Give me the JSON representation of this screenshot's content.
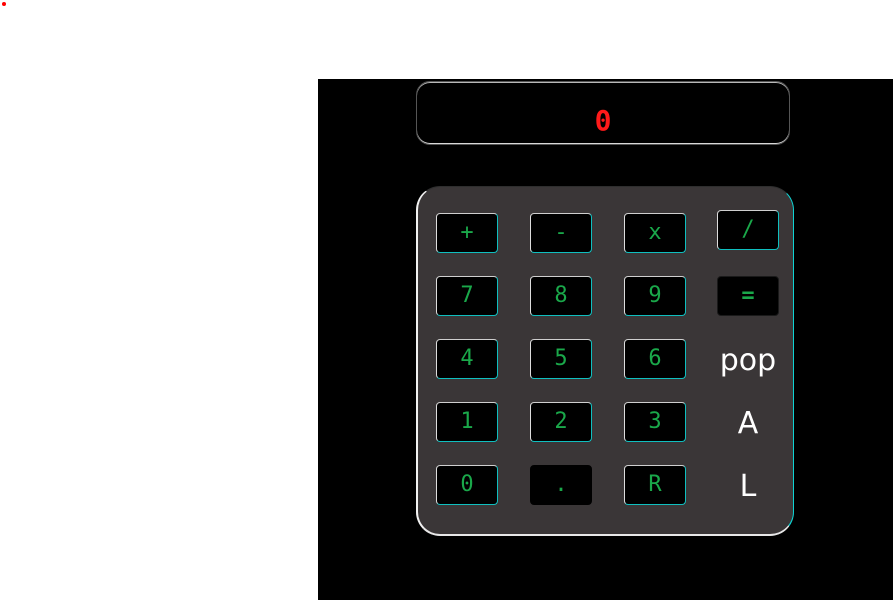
{
  "display": {
    "value": "0"
  },
  "keys": {
    "plus": "+",
    "minus": "-",
    "multiply": "x",
    "divide": "/",
    "seven": "7",
    "eight": "8",
    "nine": "9",
    "equals": "=",
    "four": "4",
    "five": "5",
    "six": "6",
    "pop": "pop",
    "one": "1",
    "two": "2",
    "three": "3",
    "a": "A",
    "zero": "0",
    "dot": ".",
    "r": "R",
    "l": "L"
  },
  "colors": {
    "display_text": "#ff1a1a",
    "key_text": "#1aa84a",
    "label_text": "#ffffff",
    "keypad_bg": "#3a3637",
    "accent_edge": "#0fbfbf"
  }
}
